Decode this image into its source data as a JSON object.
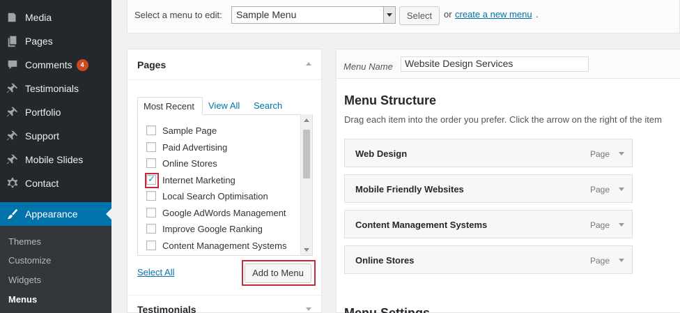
{
  "sidebar": {
    "items": [
      {
        "label": "Media",
        "icon": "media-icon"
      },
      {
        "label": "Pages",
        "icon": "pages-icon"
      },
      {
        "label": "Comments",
        "icon": "comments-icon",
        "badge": "4"
      },
      {
        "label": "Testimonials",
        "icon": "pin-icon"
      },
      {
        "label": "Portfolio",
        "icon": "pin-icon"
      },
      {
        "label": "Support",
        "icon": "pin-icon"
      },
      {
        "label": "Mobile Slides",
        "icon": "pin-icon"
      },
      {
        "label": "Contact",
        "icon": "gear-icon"
      },
      {
        "label": "Appearance",
        "icon": "brush-icon",
        "active": true
      }
    ],
    "submenu": [
      "Themes",
      "Customize",
      "Widgets",
      "Menus"
    ],
    "current_submenu": "Menus"
  },
  "topbar": {
    "select_label": "Select a menu to edit:",
    "selected_menu": "Sample Menu",
    "select_button": "Select",
    "or_text": "or",
    "create_link": "create a new menu",
    "period": "."
  },
  "left_panel": {
    "pages_title": "Pages",
    "tabs": [
      "Most Recent",
      "View All",
      "Search"
    ],
    "pages": [
      {
        "label": "Sample Page",
        "checked": false
      },
      {
        "label": "Paid Advertising",
        "checked": false
      },
      {
        "label": "Online Stores",
        "checked": false
      },
      {
        "label": "Internet Marketing",
        "checked": true
      },
      {
        "label": "Local Search Optimisation",
        "checked": false
      },
      {
        "label": "Google AdWords Management",
        "checked": false
      },
      {
        "label": "Improve Google Ranking",
        "checked": false
      },
      {
        "label": "Content Management Systems",
        "checked": false
      }
    ],
    "select_all": "Select All",
    "add_button": "Add to Menu",
    "testimonials_title": "Testimonials"
  },
  "right_panel": {
    "menu_name_label": "Menu Name",
    "menu_name_value": "Website Design Services",
    "structure_title": "Menu Structure",
    "structure_desc": "Drag each item into the order you prefer. Click the arrow on the right of the item",
    "items": [
      {
        "title": "Web Design",
        "type": "Page"
      },
      {
        "title": "Mobile Friendly Websites",
        "type": "Page"
      },
      {
        "title": "Content Management Systems",
        "type": "Page"
      },
      {
        "title": "Online Stores",
        "type": "Page"
      }
    ],
    "settings_title": "Menu Settings"
  },
  "colors": {
    "sidebar_bg": "#23282d",
    "active_bg": "#0073aa",
    "link": "#0073aa",
    "highlight_box": "#c8283a",
    "badge": "#ca4a1f"
  }
}
